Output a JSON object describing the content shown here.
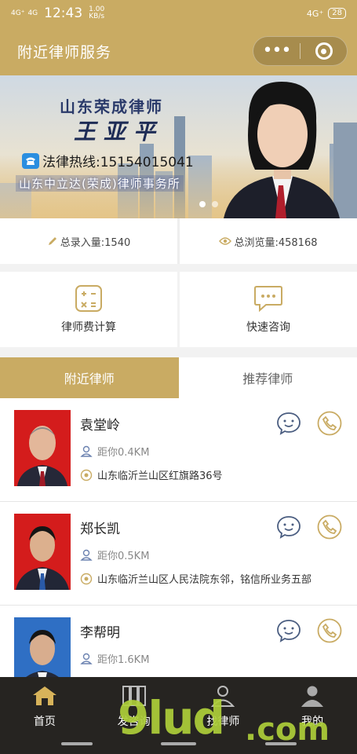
{
  "status": {
    "sig1": "4G⁺",
    "sig2": "4G",
    "time": "12:43",
    "speed": "1.00",
    "speed_unit": "KB/s",
    "right_sig": "4G⁺",
    "battery": "28"
  },
  "nav": {
    "title": "附近律师服务"
  },
  "banner": {
    "firm_title": "山东荣成律师",
    "lawyer_name": "王亚平",
    "hotline": "法律热线:15154015041",
    "office": "山东中立达(荣成)律师事务所"
  },
  "stats": {
    "records": "总录入量:1540",
    "views": "总浏览量:458168"
  },
  "tools": {
    "fee_calc": "律师费计算",
    "consult": "快速咨询"
  },
  "tabs": [
    {
      "label": "附近律师"
    },
    {
      "label": "推荐律师"
    }
  ],
  "lawyers": [
    {
      "name": "袁堂岭",
      "distance": "距你0.4KM",
      "address": "山东临沂兰山区红旗路36号"
    },
    {
      "name": "郑长凯",
      "distance": "距你0.5KM",
      "address": "山东临沂兰山区人民法院东邻，铭信所业务五部"
    },
    {
      "name": "李帮明",
      "distance": "距你1.6KM",
      "address": ""
    }
  ],
  "bottom_tabs": [
    {
      "label": "首页"
    },
    {
      "label": "发咨询"
    },
    {
      "label": "找律师"
    },
    {
      "label": "我的"
    }
  ],
  "watermark": {
    "main": "9lud",
    "tail": ".com"
  },
  "colors": {
    "brand": "#c9ab63",
    "bottom_bar": "#262421"
  }
}
